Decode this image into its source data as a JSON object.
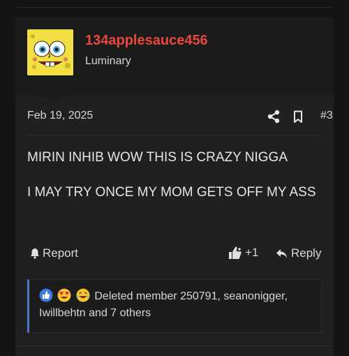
{
  "post": {
    "author": {
      "username": "134applesauce456",
      "title": "Luminary"
    },
    "date": "Feb 19, 2025",
    "number": "#3",
    "body": {
      "line1": "MIRIN INHIB WOW THIS IS CRAZY NIGGA",
      "line2": "I MAY TRY ONCE MY MOM GETS OFF MY ASS"
    },
    "actions": {
      "report": "Report",
      "reaction_count": "+1",
      "reply": "Reply"
    },
    "reactions": {
      "text": "Deleted member 250791, seanonigger, Iwillbehtn and 7 others",
      "icons": [
        "like-icon",
        "heart-eyes-icon",
        "laughing-icon"
      ]
    }
  },
  "colors": {
    "username": "#e8473d",
    "accent_bar": "#4f76c9",
    "background": "#141414",
    "panel": "#202020"
  }
}
